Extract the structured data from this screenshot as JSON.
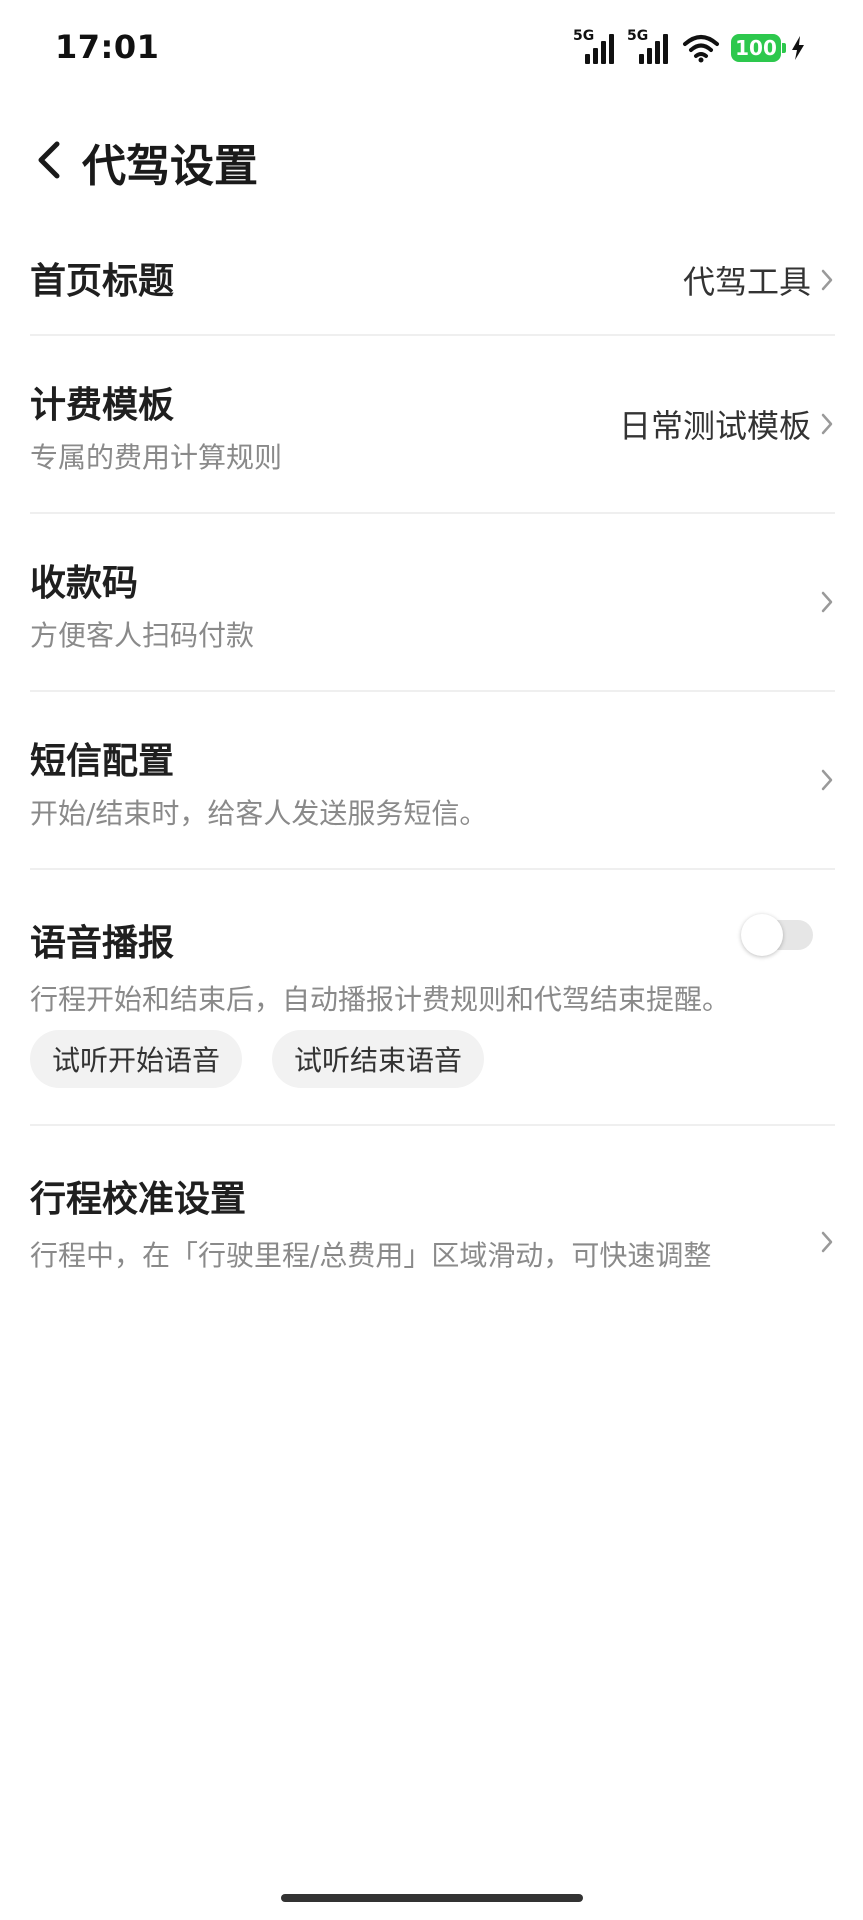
{
  "status_bar": {
    "time": "17:01",
    "signal1_label": "5G",
    "signal2_label": "5G",
    "battery": "100",
    "battery_color": "#2dc84d"
  },
  "header": {
    "title": "代驾设置",
    "back_icon": "chevron-left-icon"
  },
  "settings": {
    "home_title": {
      "title": "首页标题",
      "value": "代驾工具"
    },
    "billing_template": {
      "title": "计费模板",
      "desc": "专属的费用计算规则",
      "value": "日常测试模板"
    },
    "payment_code": {
      "title": "收款码",
      "desc": "方便客人扫码付款"
    },
    "sms_config": {
      "title": "短信配置",
      "desc": "开始/结束时，给客人发送服务短信。"
    },
    "voice_broadcast": {
      "title": "语音播报",
      "desc": "行程开始和结束后，自动播报计费规则和代驾结束提醒。",
      "toggle_on": false,
      "chip_start": "试听开始语音",
      "chip_end": "试听结束语音"
    },
    "trip_calibration": {
      "title": "行程校准设置",
      "desc": "行程中，在「行驶里程/总费用」区域滑动，可快速调整"
    }
  },
  "colors": {
    "title_text": "#1f1f1f",
    "desc_text": "#8a8a8a",
    "divider": "#efefef",
    "chip_bg": "#f2f2f2"
  }
}
